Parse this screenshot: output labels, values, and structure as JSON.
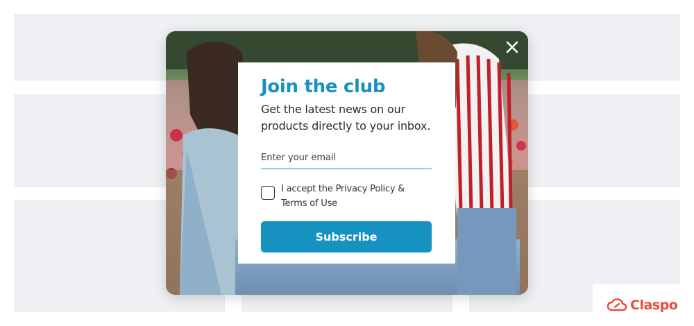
{
  "popup": {
    "title": "Join the club",
    "description": "Get the latest news on our products directly to your inbox.",
    "email_placeholder": "Enter your email",
    "email_value": "",
    "consent_label": "I accept the Privacy Policy & Terms of Use",
    "consent_checked": false,
    "subscribe_label": "Subscribe",
    "close_icon": "close-icon",
    "accent_color": "#1592bf"
  },
  "brand": {
    "name": "Claspo",
    "logo_icon": "cloud-icon",
    "color": "#ef4a3a"
  }
}
